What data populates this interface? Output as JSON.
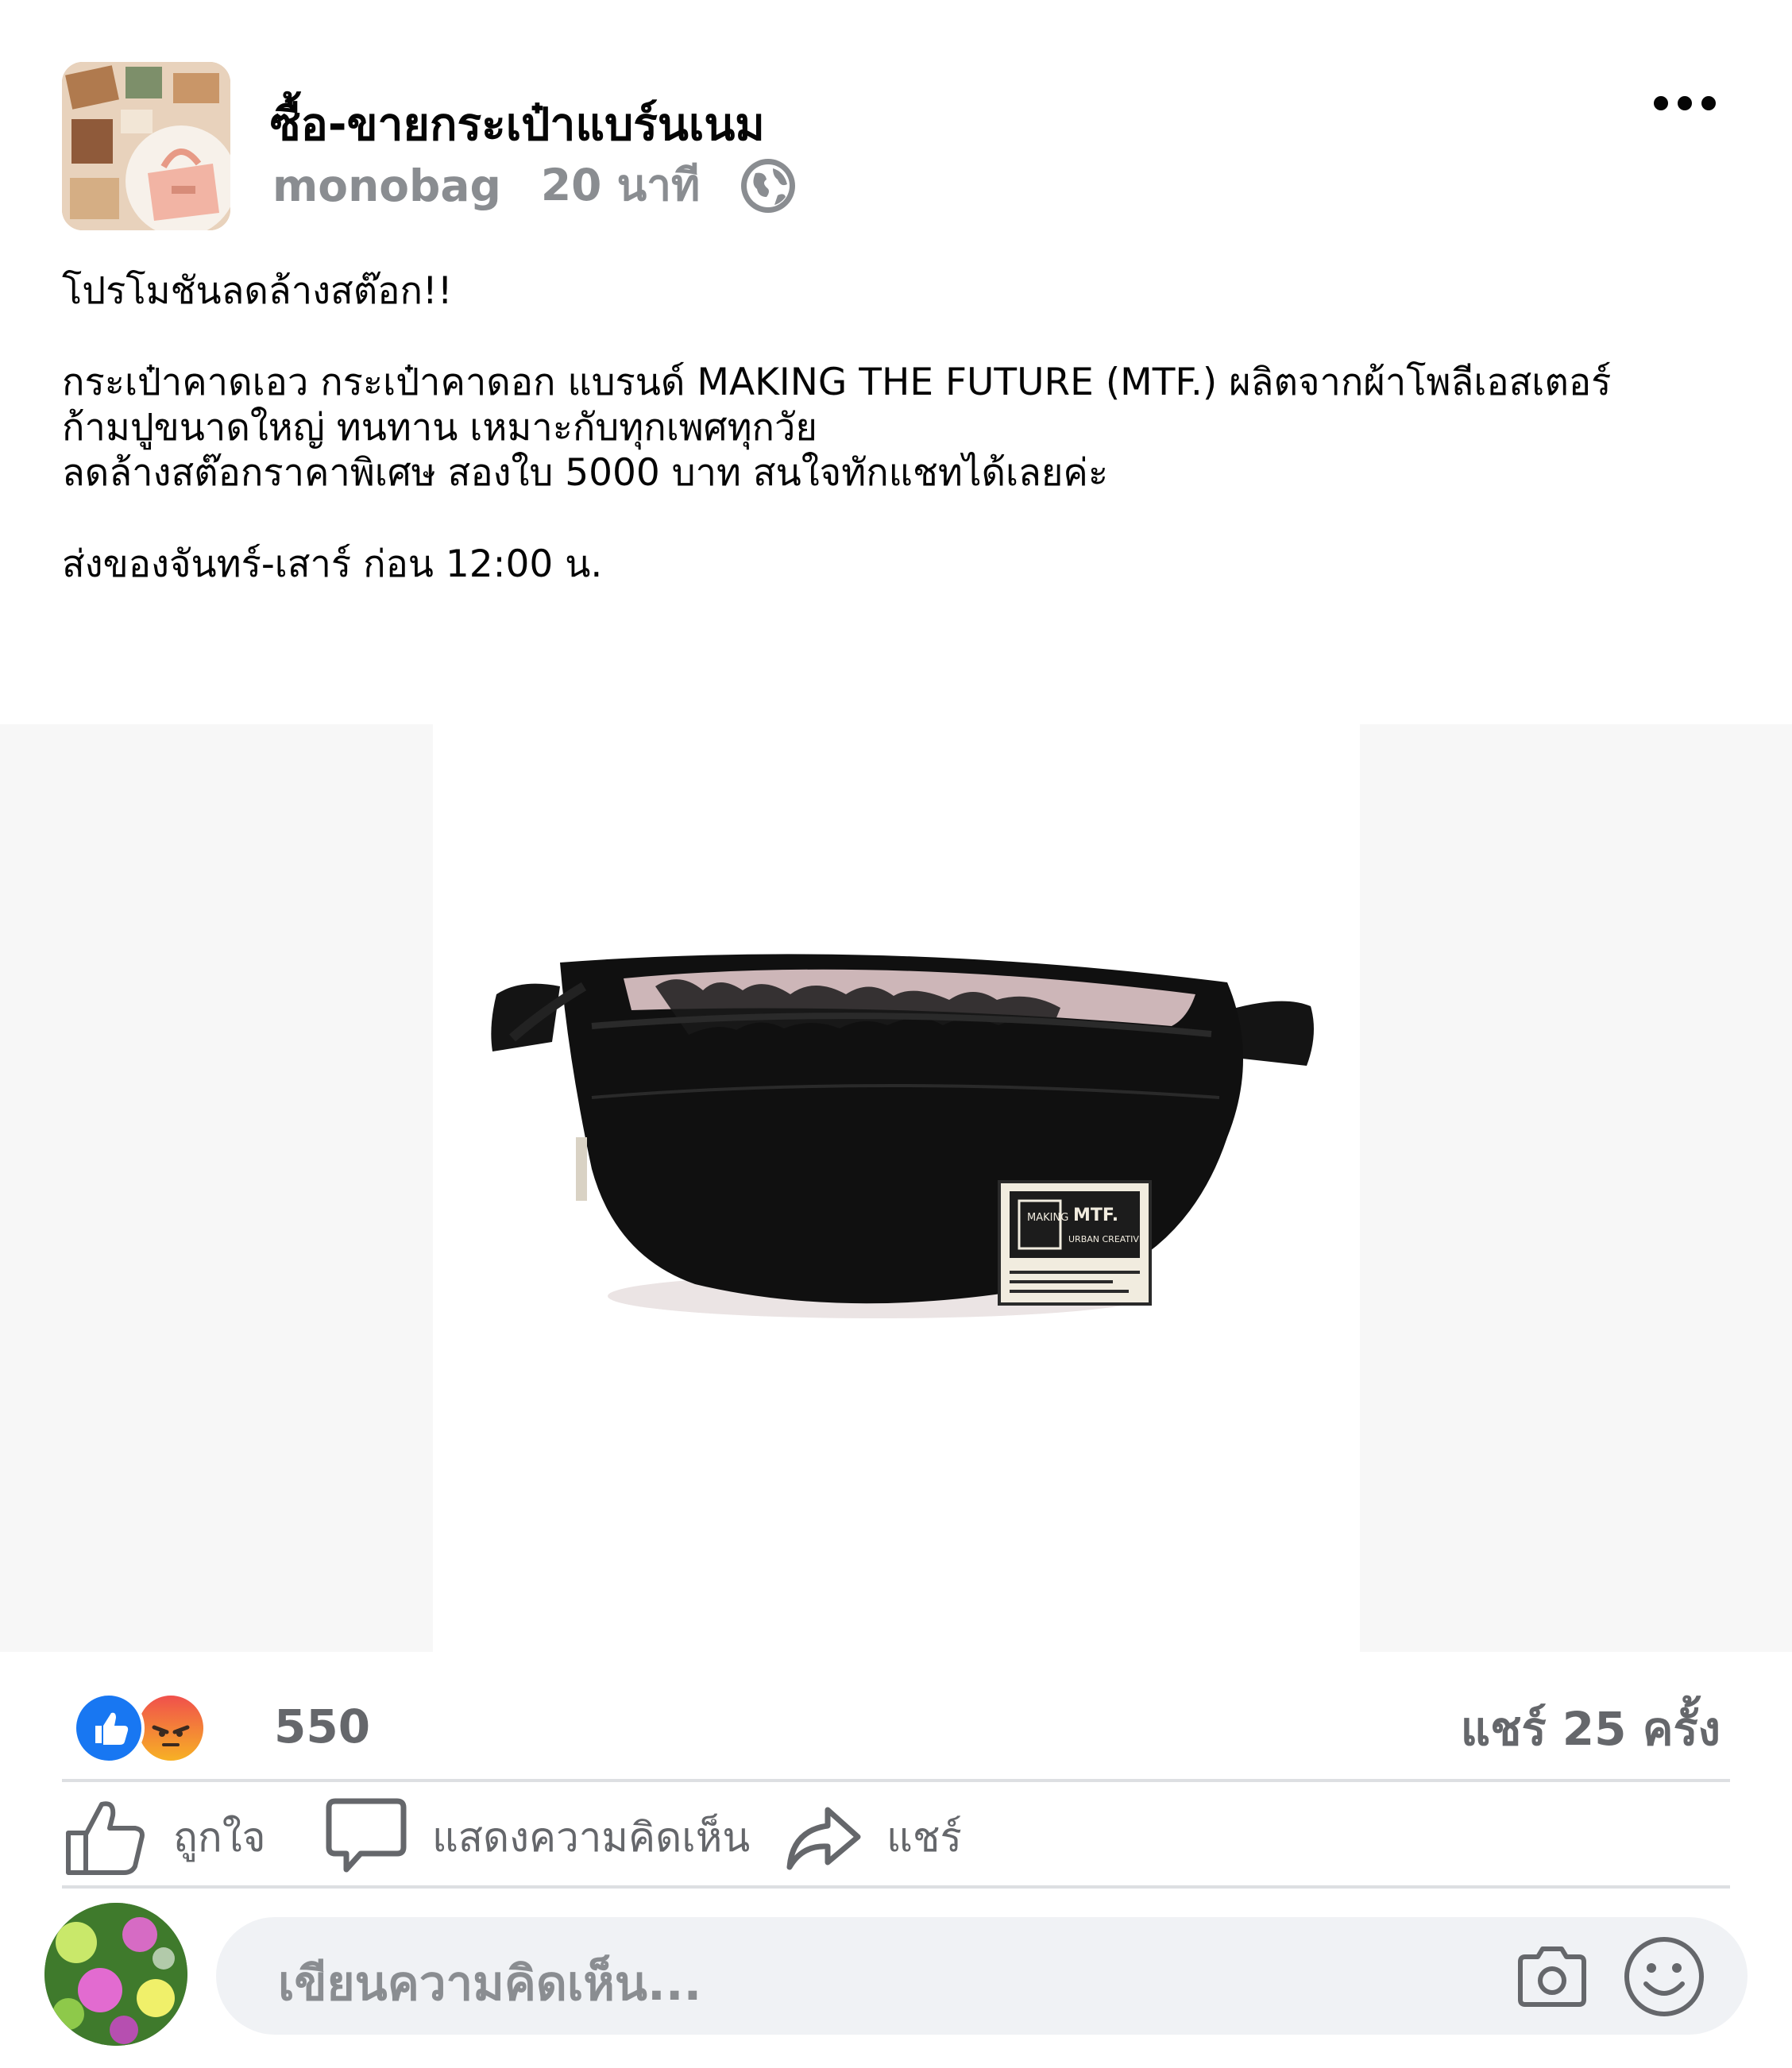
{
  "post": {
    "page_name": "ซื้อ-ขายกระเป๋าแบร์นเนม",
    "username": "monobag",
    "time": "20 นาที",
    "privacy_icon": "globe-icon",
    "more_icon": "more-options-icon"
  },
  "body": {
    "line1": "โปรโมชันลดล้างสต๊อก!!",
    "line2": "กระเป๋าคาดเอว กระเป๋าคาดอก แบรนด์ MAKING THE FUTURE (MTF.) ผลิตจากผ้าโพลีเอสเตอร์",
    "line3": "ก้ามปูขนาดใหญ่ ทนทาน เหมาะกับทุกเพศทุกวัย",
    "line4": "ลดล้างสต๊อกราคาพิเศษ สองใบ 5000 บาท สนใจทักแชทได้เลยค่ะ",
    "line5": "ส่งของจันทร์-เสาร์ ก่อน 12:00 น."
  },
  "photo": {
    "badge_brand": "MTF.",
    "badge_left": "MAKING THE FUTURE",
    "badge_right": "URBAN CREATIVE LIFE STYLES"
  },
  "stats": {
    "reaction_count": "550",
    "share_count": "แชร์ 25 ครั้ง",
    "reactions": [
      "like",
      "angry"
    ]
  },
  "actions": {
    "like": "ถูกใจ",
    "comment": "แสดงความคิดเห็น",
    "share": "แชร์"
  },
  "composer": {
    "placeholder": "เขียนความคิดเห็น..."
  },
  "colors": {
    "like_blue": "#1877f2",
    "text_secondary": "#65676b",
    "composer_bg": "#f0f2f5"
  }
}
